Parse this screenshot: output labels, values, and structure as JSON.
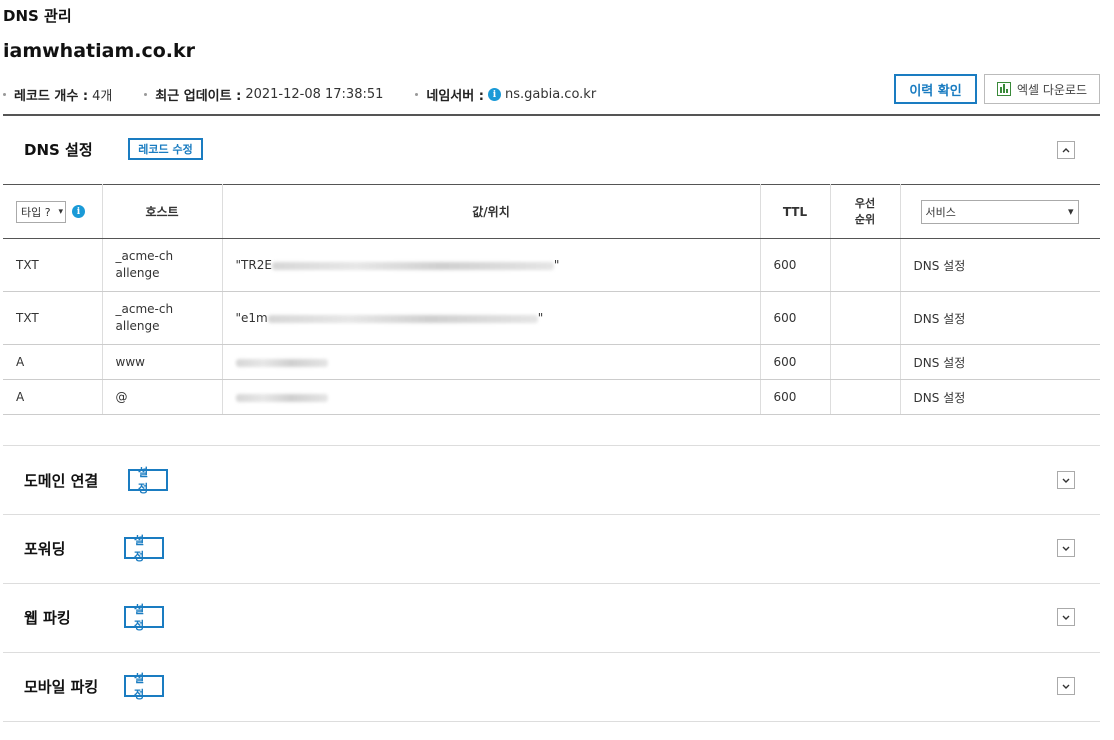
{
  "page_heading": "DNS 관리",
  "domain": "iamwhatiam.co.kr",
  "meta": {
    "record_count_label": "레코드 개수 :",
    "record_count_value": "4개",
    "last_update_label": "최근 업데이트 :",
    "last_update_value": "2021-12-08 17:38:51",
    "nameserver_label": "네임서버 :",
    "nameserver_value": "ns.gabia.co.kr"
  },
  "buttons": {
    "history": "이력 확인",
    "excel": "엑셀 다운로드"
  },
  "dns_section": {
    "title": "DNS 설정",
    "edit_button": "레코드 수정",
    "columns": {
      "type_select": "타입 ?",
      "host": "호스트",
      "value": "값/위치",
      "ttl": "TTL",
      "priority": "우선순위",
      "service_select": "서비스"
    },
    "rows": [
      {
        "type": "TXT",
        "host": "_acme-challenge",
        "value_prefix": "\"TR2E",
        "value_suffix": "\"",
        "ttl": "600",
        "priority": "",
        "service": "DNS 설정"
      },
      {
        "type": "TXT",
        "host": "_acme-challenge",
        "value_prefix": "\"e1m",
        "value_suffix": "\"",
        "ttl": "600",
        "priority": "",
        "service": "DNS 설정"
      },
      {
        "type": "A",
        "host": "www",
        "value_prefix": "",
        "value_suffix": "",
        "ttl": "600",
        "priority": "",
        "service": "DNS 설정"
      },
      {
        "type": "A",
        "host": "@",
        "value_prefix": "",
        "value_suffix": "",
        "ttl": "600",
        "priority": "",
        "service": "DNS 설정"
      }
    ]
  },
  "sections": [
    {
      "title": "도메인 연결",
      "button": "설정"
    },
    {
      "title": "포워딩",
      "button": "설정"
    },
    {
      "title": "웹 파킹",
      "button": "설정"
    },
    {
      "title": "모바일 파킹",
      "button": "설정"
    }
  ],
  "icons": {
    "info": "info-icon",
    "excel": "excel-chart-icon",
    "collapse": "chevron-up-icon",
    "expand": "chevron-down-icon"
  },
  "colors": {
    "accent": "#1a7cc1",
    "info": "#1a9ad7"
  }
}
